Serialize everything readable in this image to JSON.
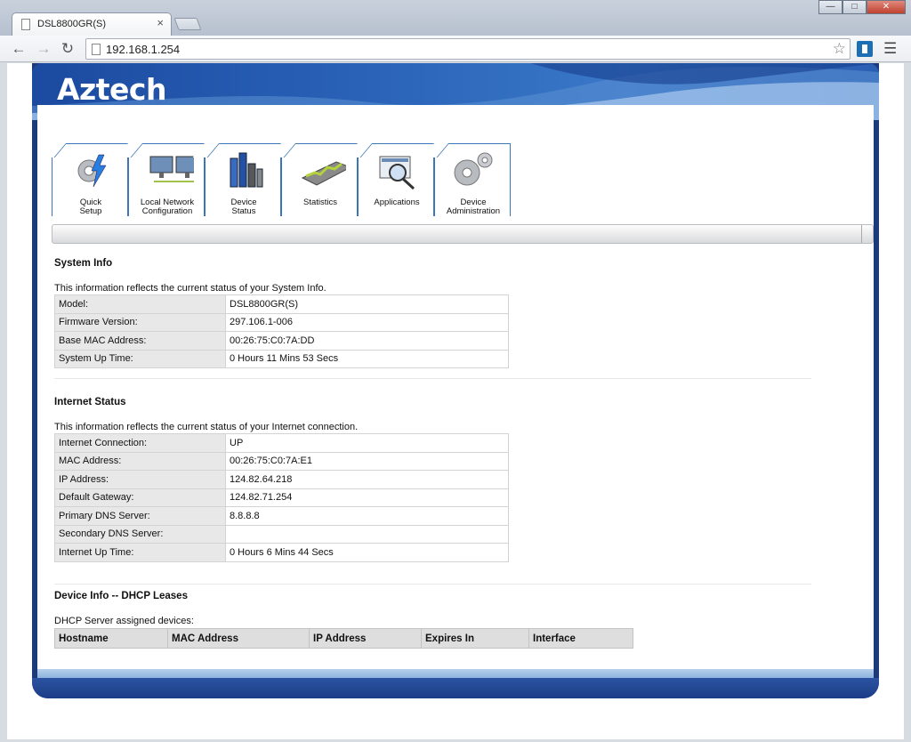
{
  "browser": {
    "tab_title": "DSL8800GR(S)",
    "tab_close": "×",
    "url": "192.168.1.254",
    "back_icon": "back-arrow-icon",
    "forward_icon": "forward-arrow-icon",
    "reload_icon": "reload-icon",
    "bookmark_icon": "star-icon",
    "menu_icon": "hamburger-menu-icon"
  },
  "header": {
    "logo": "Aztech"
  },
  "nav": [
    {
      "line1": "Quick",
      "line2": "Setup",
      "icon": "gear-lightning-icon"
    },
    {
      "line1": "Local Network",
      "line2": "Configuration",
      "icon": "monitors-icon"
    },
    {
      "line1": "Device",
      "line2": "Status",
      "icon": "bar-chart-icon"
    },
    {
      "line1": "Statistics",
      "line2": "",
      "icon": "statistics-icon"
    },
    {
      "line1": "Applications",
      "line2": "",
      "icon": "magnifier-screen-icon"
    },
    {
      "line1": "Device",
      "line2": "Administration",
      "icon": "gears-icon"
    }
  ],
  "system_info": {
    "title": "System Info",
    "desc": "This information reflects the current status of your System Info.",
    "rows": [
      {
        "key": "Model:",
        "value": "DSL8800GR(S)"
      },
      {
        "key": "Firmware Version:",
        "value": "297.106.1-006"
      },
      {
        "key": "Base MAC Address:",
        "value": "00:26:75:C0:7A:DD"
      },
      {
        "key": "System Up Time:",
        "value": "0 Hours 11 Mins 53 Secs"
      }
    ]
  },
  "internet_status": {
    "title": "Internet Status",
    "desc": "This information reflects the current status of your Internet connection.",
    "rows": [
      {
        "key": "Internet Connection:",
        "value": "UP"
      },
      {
        "key": "MAC Address:",
        "value": "00:26:75:C0:7A:E1"
      },
      {
        "key": "IP Address:",
        "value": "124.82.64.218"
      },
      {
        "key": "Default Gateway:",
        "value": "124.82.71.254"
      },
      {
        "key": "Primary DNS Server:",
        "value": "8.8.8.8"
      },
      {
        "key": "Secondary DNS Server:",
        "value": ""
      },
      {
        "key": "Internet Up Time:",
        "value": "0 Hours 6 Mins 44 Secs"
      }
    ]
  },
  "dhcp": {
    "title": "Device Info -- DHCP Leases",
    "desc": "DHCP Server assigned devices:",
    "columns": [
      "Hostname",
      "MAC Address",
      "IP Address",
      "Expires In",
      "Interface"
    ]
  }
}
